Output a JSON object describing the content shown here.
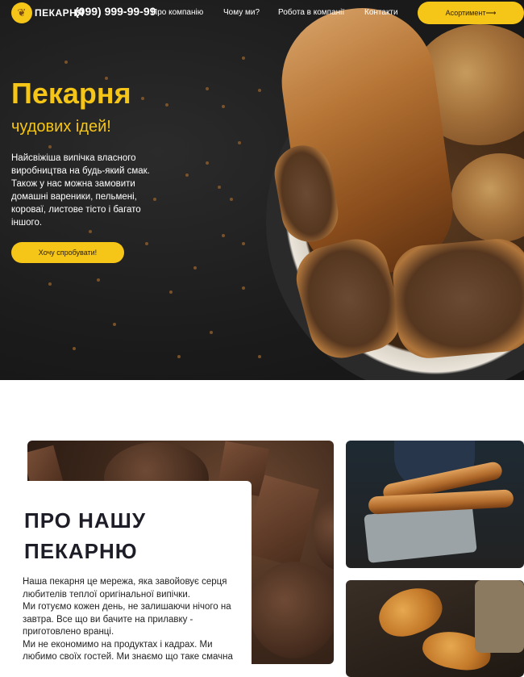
{
  "nav": {
    "logo_text": "ПЕКАРНЯ",
    "phone": "(099) 999-99-99",
    "links": [
      "Про компанію",
      "Чому ми?",
      "Робота в компанії",
      "Контакти"
    ],
    "cta_label": "Асортимент⟶"
  },
  "hero": {
    "title": "Пекарня",
    "subtitle": "чудових ідей!",
    "description": "Найсвіжіша випічка власного виробництва на будь-який смак. Також у нас можна замовити домашні вареники, пельмені, короваї, листове тісто і багато іншого.",
    "button_label": "Хочу спробувати!"
  },
  "about": {
    "title_line1": "ПРО НАШУ",
    "title_line2": "ПЕКАРНЮ",
    "paragraphs": [
      "Наша пекарня це мережа, яка завойовує серця любителів теплої оригінальної випічки.",
      "Ми готуємо кожен день, не залишаючи нічого на завтра. Все що ви бачите на прилавку - приготовлено вранці.",
      "Ми не економимо на продуктах і кадрах. Ми любимо своїх гостей. Ми знаємо що таке смачна"
    ]
  },
  "colors": {
    "accent": "#f5c518",
    "dark": "#1b1b1b",
    "heading": "#1d1d28"
  }
}
